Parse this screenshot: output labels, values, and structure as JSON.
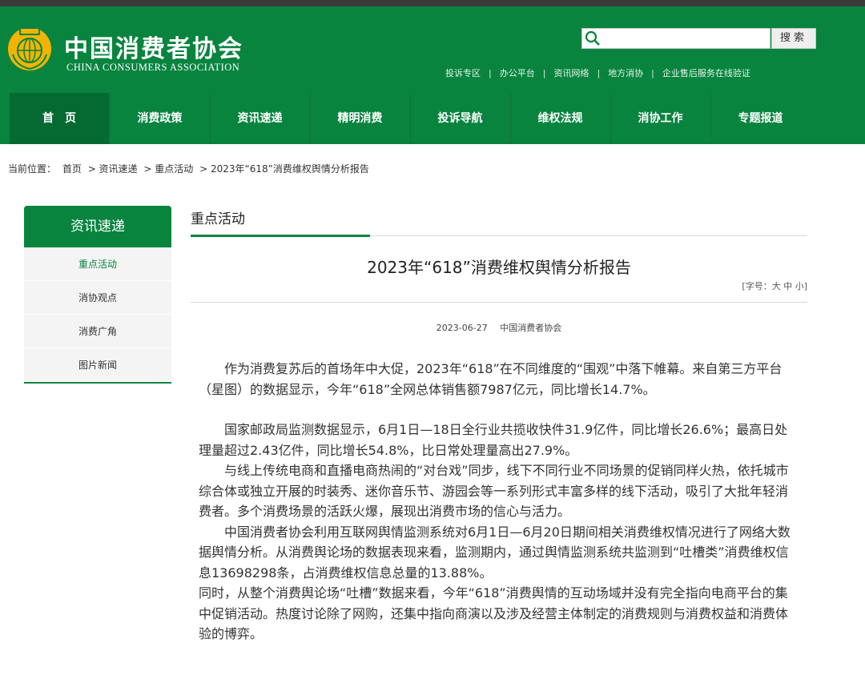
{
  "header": {
    "logo_cn": "中国消费者协会",
    "logo_en": "CHINA CONSUMERS ASSOCIATION",
    "search": {
      "placeholder": "",
      "button_label": "搜索"
    },
    "quick_links": [
      "投诉专区",
      "办公平台",
      "资讯网络",
      "地方消协",
      "企业售后服务在线验证"
    ]
  },
  "nav": {
    "items": [
      "首页",
      "消费政策",
      "资讯速递",
      "精明消费",
      "投诉导航",
      "维权法规",
      "消协工作",
      "专题报道"
    ]
  },
  "breadcrumb": {
    "prefix": "当前位置：",
    "items": [
      "首页",
      "> 资讯速递",
      "> 重点活动",
      "> 2023年“618”消费维权舆情分析报告"
    ]
  },
  "sidebar": {
    "title": "资讯速递",
    "items": [
      "重点活动",
      "消协观点",
      "消费广角",
      "图片新闻"
    ]
  },
  "main": {
    "section_title": "重点活动",
    "article_title": "2023年“618”消费维权舆情分析报告",
    "font_size_control": "[字号：大 中 小]",
    "date": "2023-06-27",
    "source": "中国消费者协会",
    "paragraphs": [
      "作为消费复苏后的首场年中大促，2023年“618”在不同维度的“围观”中落下帷幕。来自第三方平台（星图）的数据显示，今年“618”全网总体销售额7987亿元，同比增长14.7%。",
      "国家邮政局监测数据显示，6月1日—18日全行业共揽收快件31.9亿件，同比增长26.6%；最高日处理量超过2.43亿件，同比增长54.8%，比日常处理量高出27.9%。",
      "与线上传统电商和直播电商热闹的“对台戏”同步，线下不同行业不同场景的促销同样火热，依托城市综合体或独立开展的时装秀、迷你音乐节、游园会等一系列形式丰富多样的线下活动，吸引了大批年轻消费者。多个消费场景的活跃火爆，展现出消费市场的信心与活力。",
      "中国消费者协会利用互联网舆情监测系统对6月1日—6月20日期间相关消费维权情况进行了网络大数据舆情分析。从消费舆论场的数据表现来看，监测期内，通过舆情监测系统共监测到“吐槽类”消费维权信息13698298条，占消费维权信息总量的13.88%。",
      "同时，从整个消费舆论场“吐槽”数据来看，今年“618”消费舆情的互动场域并没有完全指向电商平台的集中促销活动。热度讨论除了网购，还集中指向商演以及涉及经营主体制定的消费规则与消费权益和消费体验的博弈。"
    ]
  },
  "colors": {
    "brand_green": "#08843f",
    "dark_green": "#056a31",
    "logo_gold": "#f2b400"
  },
  "icons": {
    "logo": "cca-315-emblem-icon",
    "search": "search-icon"
  }
}
